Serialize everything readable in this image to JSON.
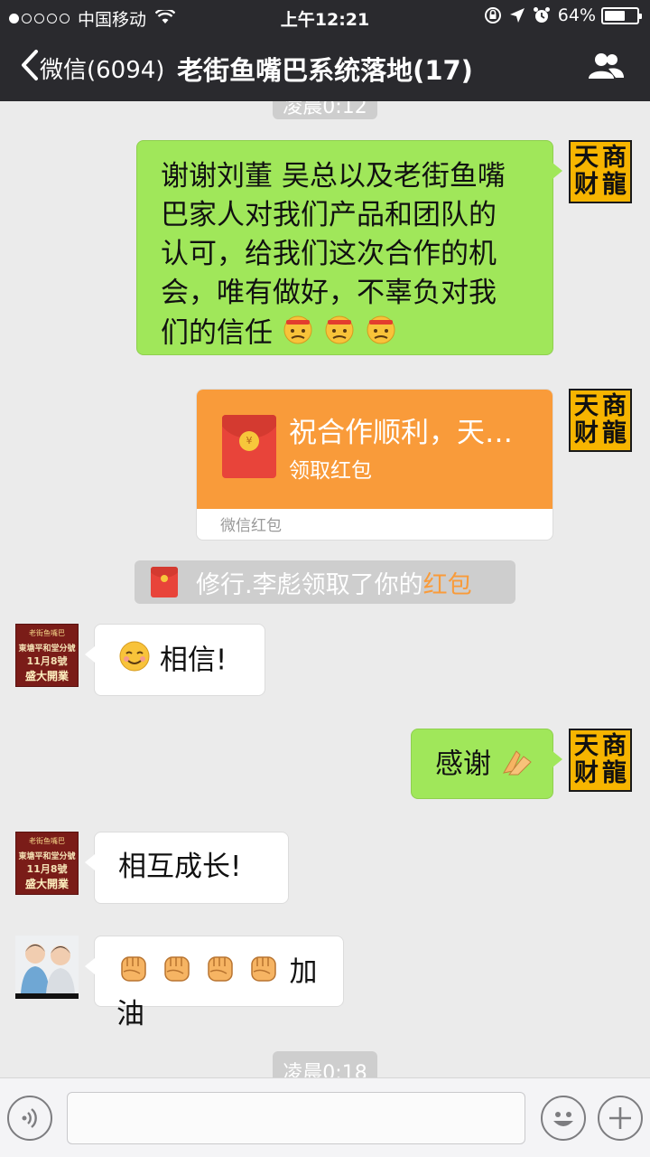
{
  "status_bar": {
    "carrier": "中国移动",
    "time": "上午12:21",
    "battery": "64%",
    "battery_level": 0.64,
    "signal_bars_filled": 1,
    "signal_bars_total": 5
  },
  "nav": {
    "back_label": "微信(6094)",
    "title": "老街鱼嘴巴系统落地(17)"
  },
  "chat": {
    "time_top": "凌晨0:12",
    "msg1": {
      "lines": [
        "谢谢刘董 吴总以及老街鱼嘴",
        "巴家人对我们产品和团队的",
        "认可，给我们这次合作的机",
        "会，唯有做好，不辜负对我",
        "们的信任"
      ]
    },
    "brand_avatar": [
      "天",
      "商",
      "财",
      "龍"
    ],
    "redpacket": {
      "title": "祝合作顺利，天…",
      "subtitle": "领取红包",
      "footer": "微信红包"
    },
    "system_msg": {
      "prefix": "修行.李彪领取了你的",
      "highlight": "红包"
    },
    "shop_avatar": {
      "l1": "老街鱼嘴巴",
      "l2": "東塘平和堂分號",
      "l3": "11月8號",
      "l4": "盛大開業"
    },
    "msg_believe": "相信!",
    "msg_thanks": "感谢",
    "msg_grow": "相互成长!",
    "msg_cheer": "加油",
    "time_bottom": "凌晨0:18"
  },
  "colors": {
    "nav_bg": "#2a2a2e",
    "chat_bg": "#ebebeb",
    "green_bubble": "#a0e75a",
    "redpacket": "#f99b3a",
    "highlight": "#f99b3a"
  }
}
